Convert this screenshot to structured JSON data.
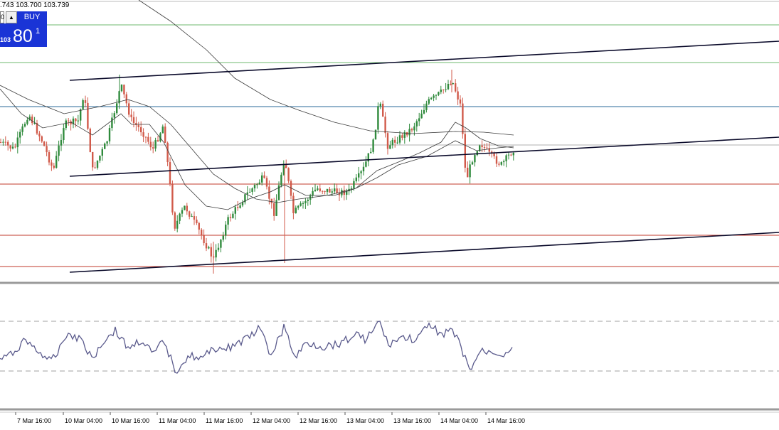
{
  "quote": {
    "prices_text": ".743 103.700 103.739"
  },
  "trade_panel": {
    "buy_label": "BUY",
    "price_prefix": "103",
    "price_big": "80",
    "price_sup": "1",
    "spin_value": "0",
    "up_arrow": "▲"
  },
  "colors": {
    "candle_up": "#2f8a3c",
    "candle_down": "#d15a4a",
    "ma": "#3a3a3a",
    "trendline": "#0a0a2a",
    "oscillator": "#5a5a8c",
    "resistance_green": "#6fb86f",
    "support_red": "#c0392b",
    "pivot_blue": "#2a6a9a"
  },
  "time_axis": {
    "labels": [
      "7 Mar 16:00",
      "10 Mar 04:00",
      "10 Mar 16:00",
      "11 Mar 04:00",
      "11 Mar 16:00",
      "12 Mar 04:00",
      "12 Mar 16:00",
      "13 Mar 04:00",
      "13 Mar 16:00",
      "14 Mar 04:00",
      "14 Mar 16:00"
    ]
  }
}
